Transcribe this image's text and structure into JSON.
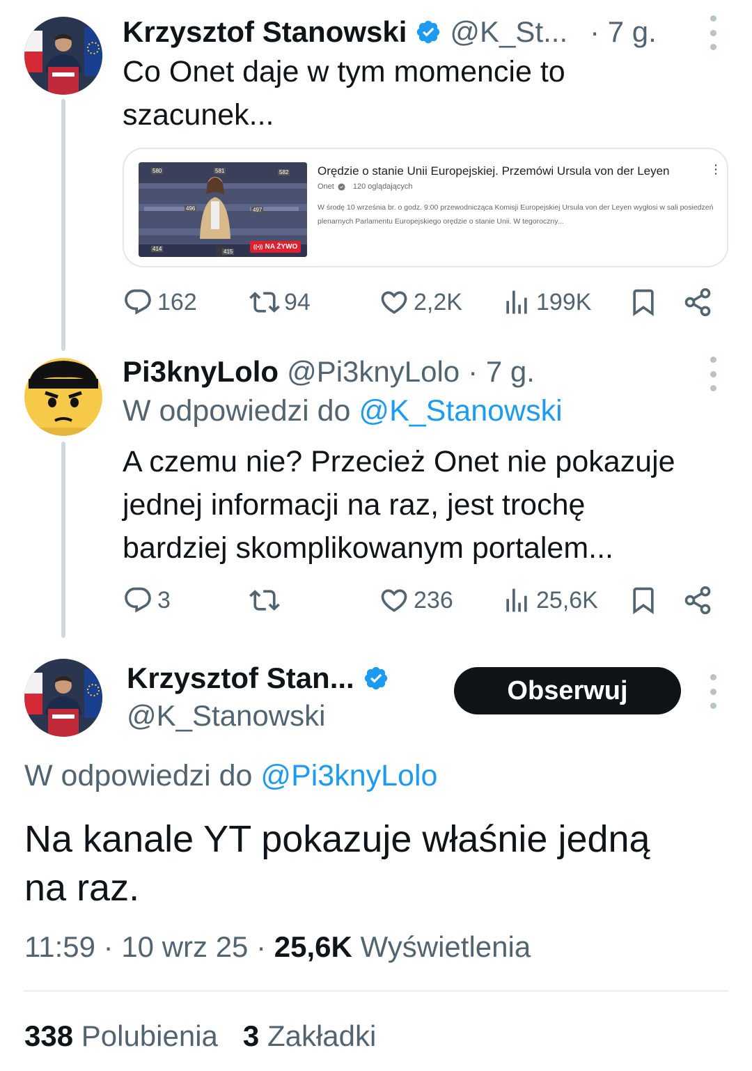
{
  "tweet1": {
    "name": "Krzysztof Stanowski",
    "handle": "@K_St...",
    "time": "· 7 g.",
    "text_line1": "Co Onet daje w tym momencie to",
    "text_line2": "szacunek...",
    "card": {
      "title": "Orędzie o stanie Unii Europejskiej. Przemówi Ursula von der Leyen",
      "channel": "Onet",
      "viewers": "120 oglądających",
      "desc": "W środę 10 września br. o godz. 9:00 przewodnicząca Komisji Europejskiej Ursula von der Leyen wygłosi w sali posiedzeń plenarnych Parlamentu Europejskiego orędzie o stanie Unii. W tegoroczny...",
      "live_badge": "NA ŻYWO",
      "seat_labels": [
        "580",
        "581",
        "582",
        "496",
        "497",
        "414",
        "415"
      ]
    },
    "actions": {
      "replies": "162",
      "reposts": "94",
      "likes": "2,2K",
      "views": "199K"
    }
  },
  "tweet2": {
    "name": "Pi3knyLolo",
    "handle": "@Pi3knyLolo",
    "time": "· 7 g.",
    "reply_prefix": "W odpowiedzi do",
    "reply_handle": "@K_Stanowski",
    "text_line1": "A czemu nie? Przecież Onet nie pokazuje",
    "text_line2": "jednej informacji na raz, jest trochę",
    "text_line3": "bardziej skomplikowanym portalem...",
    "actions": {
      "replies": "3",
      "reposts": "",
      "likes": "236",
      "views": "25,6K"
    }
  },
  "main": {
    "name": "Krzysztof Stan...",
    "handle": "@K_Stanowski",
    "follow_label": "Obserwuj",
    "reply_prefix": "W odpowiedzi do",
    "reply_handle": "@Pi3knyLolo",
    "text_line1": "Na kanale YT pokazuje właśnie jedną",
    "text_line2": "na raz.",
    "time": "11:59",
    "date": "10 wrz 25",
    "views_count": "25,6K",
    "views_label": "Wyświetlenia",
    "likes_count": "338",
    "likes_label": "Polubienia",
    "bookmarks_count": "3",
    "bookmarks_label": "Zakładki"
  },
  "colors": {
    "link": "#1d9bf0",
    "secondary_text": "#536471",
    "thread_line": "#cfd9de",
    "follow_button": "#0f1419",
    "live_badge": "#e0202c"
  },
  "icons": [
    "verified-badge-icon",
    "more-icon",
    "reply-icon",
    "repost-icon",
    "like-icon",
    "views-icon",
    "bookmark-icon",
    "share-icon"
  ]
}
